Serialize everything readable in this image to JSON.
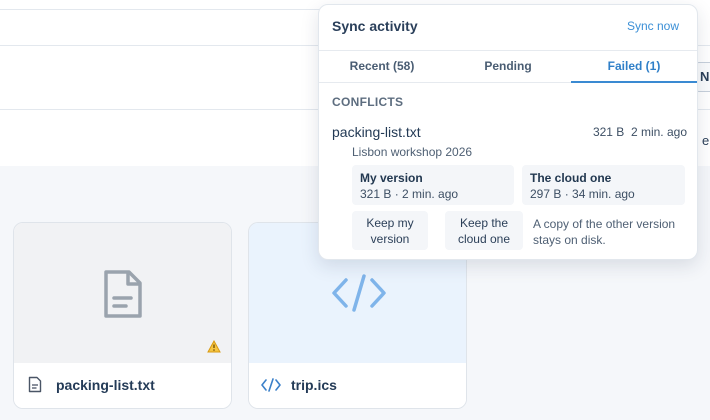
{
  "background": {
    "edge_button_label": "N",
    "edge_text": "e"
  },
  "files": [
    {
      "name": "packing-list.txt",
      "icon": "document-icon",
      "warning_icon": "warning-icon"
    },
    {
      "name": "trip.ics",
      "icon": "code-icon"
    }
  ],
  "sync_popover": {
    "title": "Sync activity",
    "sync_now": "Sync now",
    "tabs": [
      {
        "label": "Recent (58)",
        "active": false
      },
      {
        "label": "Pending",
        "active": false
      },
      {
        "label": "Failed (1)",
        "active": true
      }
    ],
    "section_title": "CONFLICTS",
    "conflict": {
      "file": "packing-list.txt",
      "meta": "321 B  2 min. ago",
      "project": "Lisbon workshop 2026",
      "mine": {
        "title": "My version",
        "meta": "321 B · 2 min. ago"
      },
      "cloud": {
        "title": "The cloud one",
        "meta": "297 B · 34 min. ago"
      },
      "keep_mine": "Keep my version",
      "keep_cloud": "Keep the cloud one",
      "note": "A copy of the other version stays on disk."
    }
  },
  "colors": {
    "accent": "#3a8ad2",
    "warning": "#e6a817"
  }
}
